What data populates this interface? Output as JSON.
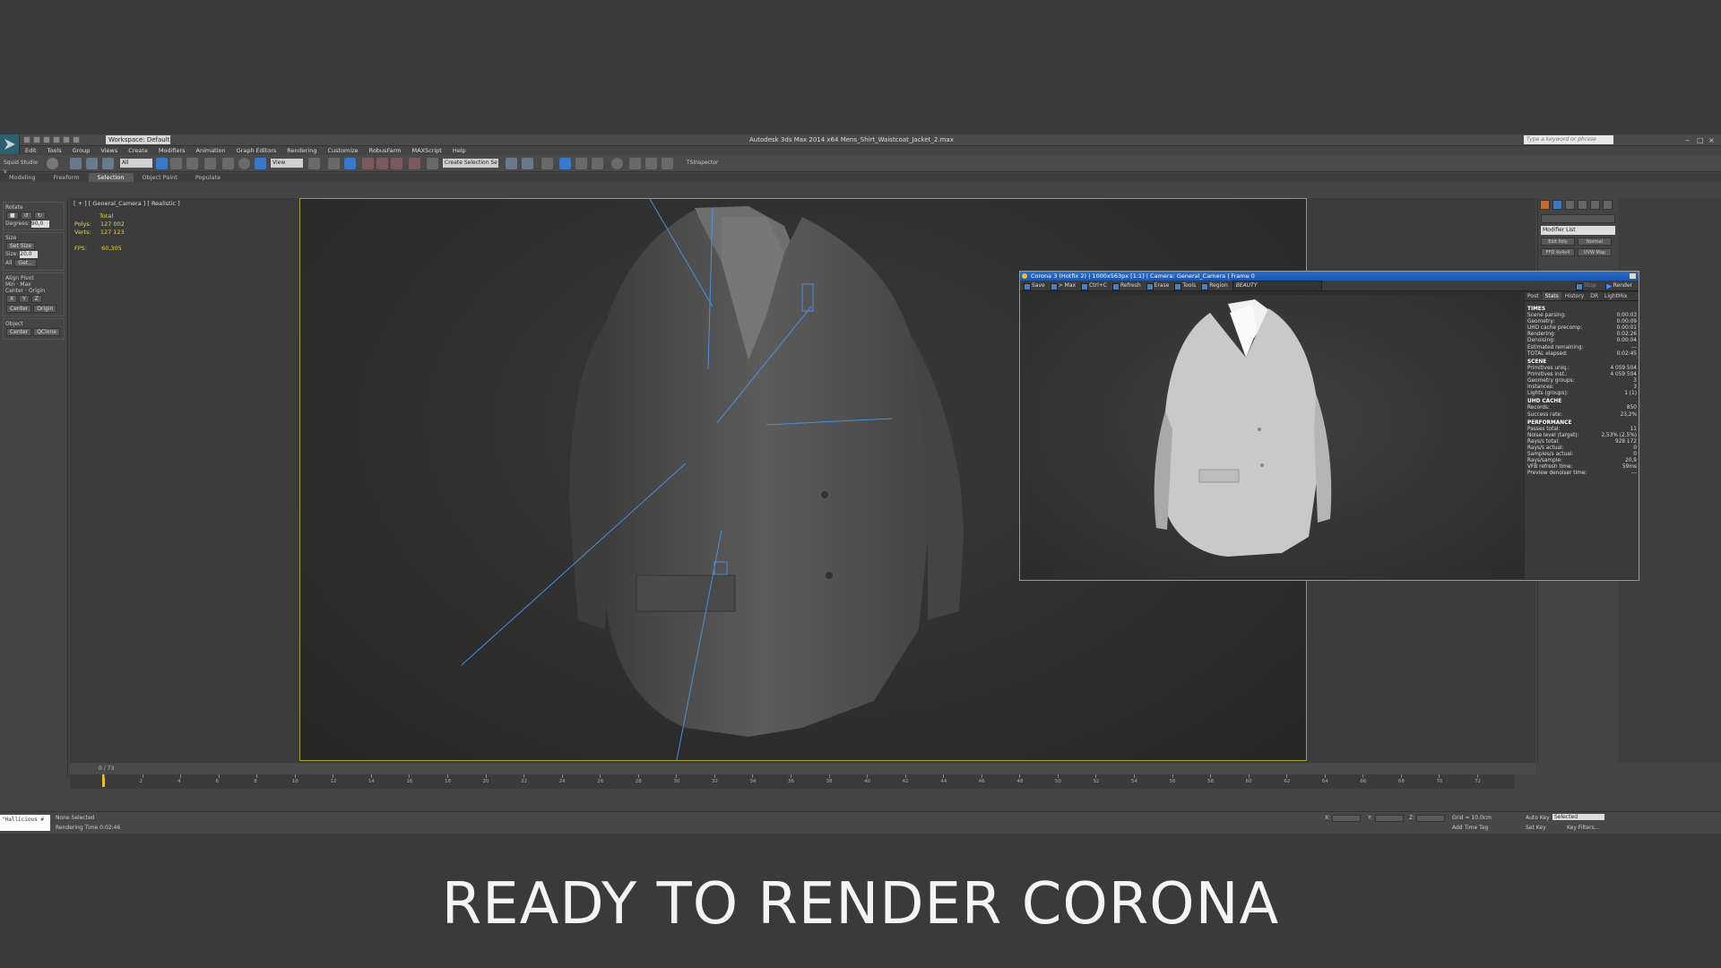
{
  "app": {
    "workspace": "Workspace: Default",
    "title": "Autodesk 3ds Max  2014 x64     Mens_Shirt_Waistcoat_Jacket_2.max",
    "search_placeholder": "Type a keyword or phrase"
  },
  "menu": [
    "Edit",
    "Tools",
    "Group",
    "Views",
    "Create",
    "Modifiers",
    "Animation",
    "Graph Editors",
    "Rendering",
    "Customize",
    "RobusFarm",
    "MAXScript",
    "Help"
  ],
  "toolbar": {
    "studio": "Squid Studio v",
    "filter": "All",
    "view": "View",
    "selection_set": "Create Selection Se",
    "tsinspector": "TSInspector"
  },
  "ribbon": [
    "Modeling",
    "Freeform",
    "Selection",
    "Object Paint",
    "Populate"
  ],
  "left_panel": {
    "rotate_title": "Rotate",
    "degrees_label": "Degrees:",
    "degrees_value": "90,0",
    "size_title": "Size",
    "set_size": "Set Size",
    "size_label": "Size:",
    "size_value": "20,0",
    "all": "All",
    "get": "Get...",
    "align_pivot": "Align Pivot",
    "min": "Min",
    "max": "Max",
    "center": "Center",
    "origin": "Origin",
    "x": "X",
    "y": "Y",
    "z": "Z",
    "object_title": "Object",
    "qclone": "QClone"
  },
  "viewport": {
    "label": "[ + ] [ General_Camera ] [ Realistic ]",
    "stats_header": "Total",
    "polys_label": "Polys:",
    "polys_value": "127 002",
    "verts_label": "Verts:",
    "verts_value": "127 123",
    "fps_label": "FPS:",
    "fps_value": "60,305"
  },
  "right_panel": {
    "modifier_list": "Modifier List",
    "buttons": [
      "Edit Poly",
      "Normal",
      "FFD 4x4x4",
      "UVW Map"
    ]
  },
  "corona": {
    "title": "Corona 3 (Hotfix 2) | 1000x563px [1:1] | Camera: General_Camera | Frame 0",
    "tools": [
      "Save",
      "> Max",
      "Ctrl+C",
      "Refresh",
      "Erase",
      "Tools",
      "Region"
    ],
    "pass": "BEAUTY",
    "stop": "Stop",
    "render": "Render",
    "tabs": [
      "Post",
      "Stats",
      "History",
      "DR",
      "LightMix"
    ],
    "active_tab": "Stats",
    "sections": [
      {
        "name": "TIMES",
        "rows": [
          [
            "Scene parsing:",
            "0:00:03"
          ],
          [
            "Geometry:",
            "0:00:09"
          ],
          [
            "UHD cache precomp:",
            "0:00:01"
          ],
          [
            "Rendering:",
            "0:02:26"
          ],
          [
            "Denoising:",
            "0:00:04"
          ],
          [
            "Estimated remaining:",
            "---"
          ],
          [
            "TOTAL elapsed:",
            "0:02:45"
          ]
        ]
      },
      {
        "name": "SCENE",
        "rows": [
          [
            "Primitives uniq.:",
            "4 059 504"
          ],
          [
            "Primitives inst.:",
            "4 059 504"
          ],
          [
            "Geometry groups:",
            "3"
          ],
          [
            "Instances:",
            "3"
          ],
          [
            "Lights (groups):",
            "1 (1)"
          ]
        ]
      },
      {
        "name": "UHD CACHE",
        "rows": [
          [
            "Records:",
            "850"
          ],
          [
            "Success rate:",
            "23,2%"
          ]
        ]
      },
      {
        "name": "PERFORMANCE",
        "rows": [
          [
            "Passes total:",
            "11"
          ],
          [
            "Noise level (target):",
            "2,53% (2,5%)"
          ],
          [
            "Rays/s total:",
            "928 172"
          ],
          [
            "Rays/s actual:",
            "0"
          ],
          [
            "Samples/s actual:",
            "0"
          ],
          [
            "Rays/sample:",
            "20,9"
          ],
          [
            "VFB refresh time:",
            "59ms"
          ],
          [
            "Preview denoiser time:",
            "---"
          ]
        ]
      }
    ]
  },
  "timeline": {
    "frame": "0 / 73",
    "ticks": [
      "0",
      "2",
      "4",
      "6",
      "8",
      "10",
      "12",
      "14",
      "16",
      "18",
      "20",
      "22",
      "24",
      "26",
      "28",
      "30",
      "32",
      "34",
      "36",
      "38",
      "40",
      "42",
      "44",
      "46",
      "48",
      "50",
      "52",
      "54",
      "56",
      "58",
      "60",
      "62",
      "64",
      "66",
      "68",
      "70",
      "72"
    ]
  },
  "status": {
    "maxscript": "\"Hallicious #",
    "selection": "None Selected",
    "render_time": "Rendering Time  0:02:46",
    "x_label": "X:",
    "y_label": "Y:",
    "z_label": "Z:",
    "grid": "Grid = 10,0cm",
    "add_time_tag": "Add Time Tag",
    "auto_key": "Auto Key",
    "selected": "Selected",
    "set_key": "Set Key",
    "key_filters": "Key Filters..."
  },
  "caption": "READY TO RENDER  CORONA"
}
